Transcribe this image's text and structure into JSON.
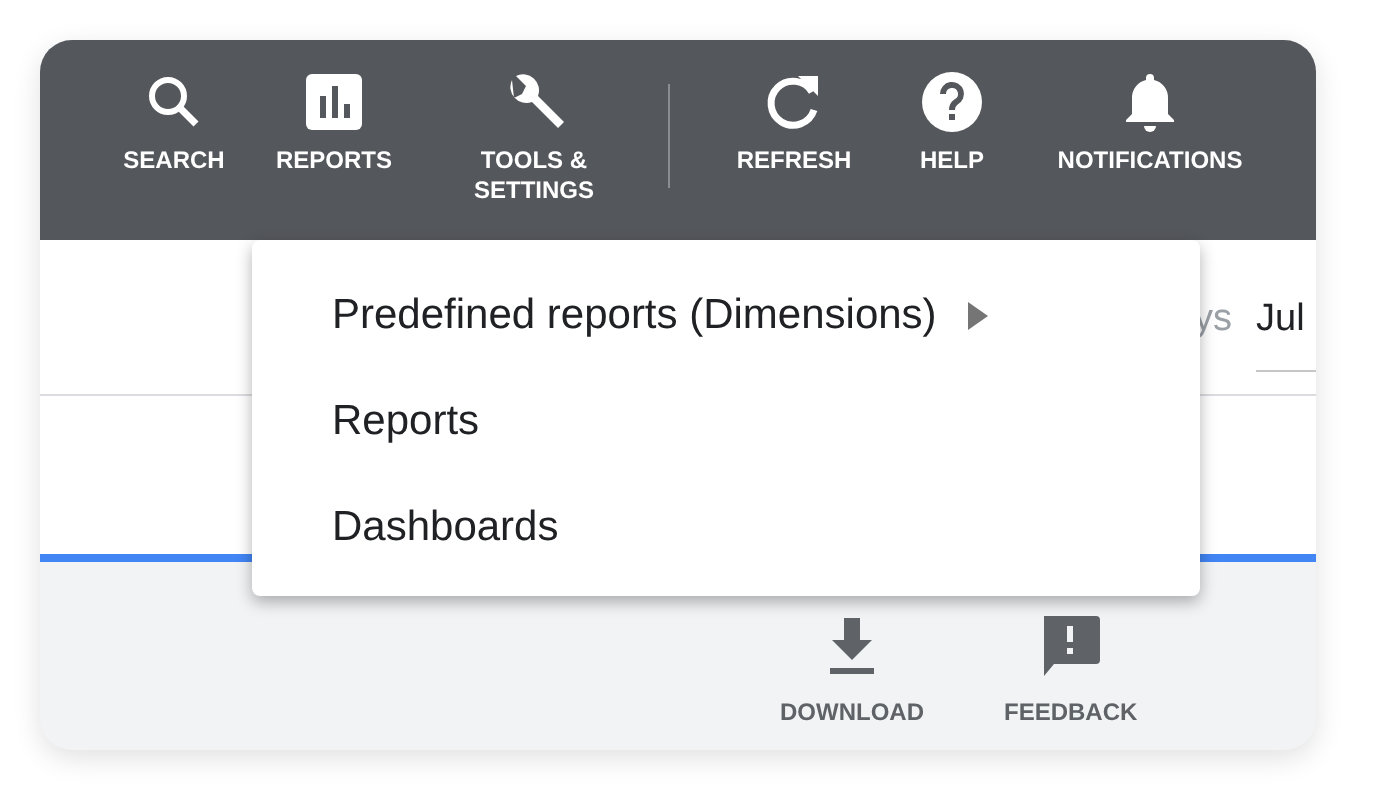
{
  "toolbar": {
    "groups": [
      [
        {
          "label": "SEARCH"
        },
        {
          "label": "REPORTS"
        },
        {
          "label": "TOOLS &\nSETTINGS"
        }
      ],
      [
        {
          "label": "REFRESH"
        },
        {
          "label": "HELP"
        },
        {
          "label": "NOTIFICATIONS"
        }
      ]
    ]
  },
  "header_fragments": {
    "label_fragment": "ys",
    "date_fragment": "Jul"
  },
  "menu": {
    "items": [
      {
        "label": "Predefined reports (Dimensions)",
        "has_submenu": true
      },
      {
        "label": "Reports",
        "has_submenu": false
      },
      {
        "label": "Dashboards",
        "has_submenu": false
      }
    ]
  },
  "actions": [
    {
      "label": "DOWNLOAD"
    },
    {
      "label": "FEEDBACK"
    }
  ]
}
